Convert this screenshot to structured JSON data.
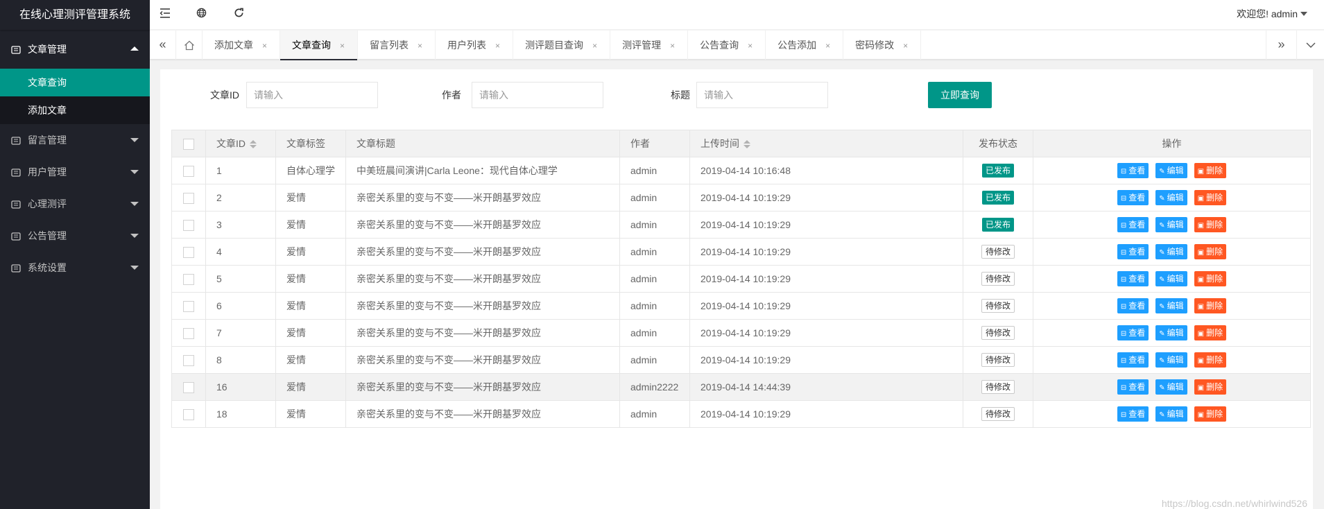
{
  "app": {
    "title": "在线心理测评管理系统"
  },
  "header": {
    "collapse_icon": "menu-fold-icon",
    "website_icon": "globe-icon",
    "refresh_icon": "refresh-icon",
    "welcome": "欢迎您!  admin"
  },
  "sidebar": {
    "groups": [
      {
        "label": "文章管理",
        "icon": "book-icon",
        "expanded": true,
        "items": [
          {
            "label": "文章查询",
            "current": true
          },
          {
            "label": "添加文章",
            "current": false
          }
        ]
      },
      {
        "label": "留言管理",
        "icon": "message-icon",
        "expanded": false
      },
      {
        "label": "用户管理",
        "icon": "user-icon",
        "expanded": false
      },
      {
        "label": "心理测评",
        "icon": "clipboard-icon",
        "expanded": false
      },
      {
        "label": "公告管理",
        "icon": "bullhorn-icon",
        "expanded": false
      },
      {
        "label": "系统设置",
        "icon": "settings-icon",
        "expanded": false
      }
    ]
  },
  "tabs": {
    "items": [
      {
        "label": "添加文章",
        "active": false
      },
      {
        "label": "文章查询",
        "active": true
      },
      {
        "label": "留言列表",
        "active": false
      },
      {
        "label": "用户列表",
        "active": false
      },
      {
        "label": "测评题目查询",
        "active": false
      },
      {
        "label": "测评管理",
        "active": false
      },
      {
        "label": "公告查询",
        "active": false
      },
      {
        "label": "公告添加",
        "active": false
      },
      {
        "label": "密码修改",
        "active": false
      }
    ],
    "close_glyph": "×"
  },
  "search": {
    "id_label": "文章ID",
    "author_label": "作者",
    "title_label": "标题",
    "placeholder": "请输入",
    "id_value": "",
    "author_value": "",
    "title_value": "",
    "submit_label": "立即查询"
  },
  "table": {
    "headers": {
      "id": "文章ID",
      "tag": "文章标签",
      "title": "文章标题",
      "author": "作者",
      "time": "上传时间",
      "status": "发布状态",
      "ops": "操作"
    },
    "actions": {
      "view": "查看",
      "edit": "编辑",
      "delete": "删除"
    },
    "rows": [
      {
        "id": "1",
        "tag": "自体心理学",
        "title": "中美班晨间演讲|Carla Leone：现代自体心理学",
        "author": "admin",
        "time": "2019-04-14 10:16:48",
        "status": "已发布",
        "published": true
      },
      {
        "id": "2",
        "tag": "爱情",
        "title": "亲密关系里的变与不变——米开朗基罗效应",
        "author": "admin",
        "time": "2019-04-14 10:19:29",
        "status": "已发布",
        "published": true
      },
      {
        "id": "3",
        "tag": "爱情",
        "title": "亲密关系里的变与不变——米开朗基罗效应",
        "author": "admin",
        "time": "2019-04-14 10:19:29",
        "status": "已发布",
        "published": true
      },
      {
        "id": "4",
        "tag": "爱情",
        "title": "亲密关系里的变与不变——米开朗基罗效应",
        "author": "admin",
        "time": "2019-04-14 10:19:29",
        "status": "待修改",
        "published": false
      },
      {
        "id": "5",
        "tag": "爱情",
        "title": "亲密关系里的变与不变——米开朗基罗效应",
        "author": "admin",
        "time": "2019-04-14 10:19:29",
        "status": "待修改",
        "published": false
      },
      {
        "id": "6",
        "tag": "爱情",
        "title": "亲密关系里的变与不变——米开朗基罗效应",
        "author": "admin",
        "time": "2019-04-14 10:19:29",
        "status": "待修改",
        "published": false
      },
      {
        "id": "7",
        "tag": "爱情",
        "title": "亲密关系里的变与不变——米开朗基罗效应",
        "author": "admin",
        "time": "2019-04-14 10:19:29",
        "status": "待修改",
        "published": false
      },
      {
        "id": "8",
        "tag": "爱情",
        "title": "亲密关系里的变与不变——米开朗基罗效应",
        "author": "admin",
        "time": "2019-04-14 10:19:29",
        "status": "待修改",
        "published": false
      },
      {
        "id": "16",
        "tag": "爱情",
        "title": "亲密关系里的变与不变——米开朗基罗效应",
        "author": "admin2222",
        "time": "2019-04-14 14:44:39",
        "status": "待修改",
        "published": false,
        "highlighted": true
      },
      {
        "id": "18",
        "tag": "爱情",
        "title": "亲密关系里的变与不变——米开朗基罗效应",
        "author": "admin",
        "time": "2019-04-14 10:19:29",
        "status": "待修改",
        "published": false
      }
    ]
  },
  "watermark": "https://blog.csdn.net/whirlwind526",
  "colors": {
    "sidebar": "#20222a",
    "accent": "#009688",
    "blue": "#1e9fff",
    "danger": "#ff5722"
  }
}
